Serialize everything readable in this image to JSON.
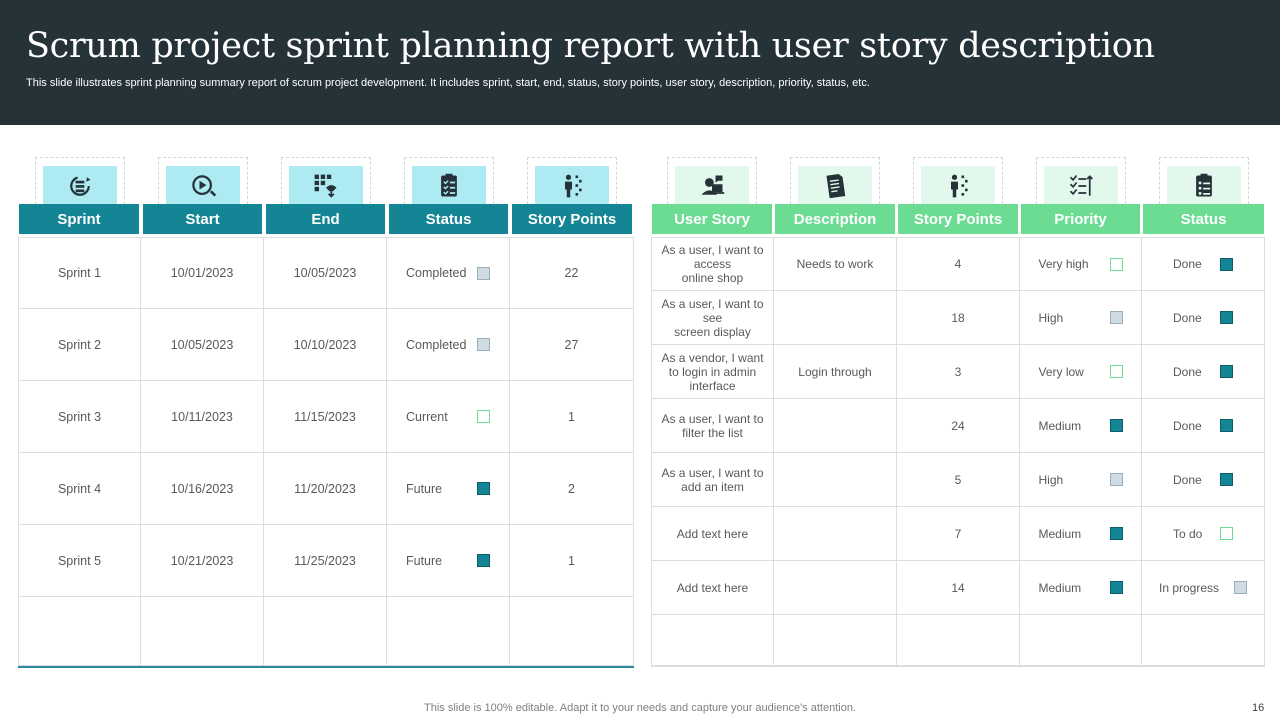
{
  "header": {
    "title": "Scrum project sprint planning report with user story description",
    "subtitle": "This slide illustrates sprint planning summary report of scrum project development. It includes sprint, start, end, status, story points, user story, description, priority, status, etc."
  },
  "left_table": {
    "columns": [
      "Sprint",
      "Start",
      "End",
      "Status",
      "Story Points"
    ],
    "icons": [
      "sprint-cycle-icon",
      "start-clock-icon",
      "end-calendar-icon",
      "status-checklist-icon",
      "story-points-icon"
    ],
    "rows": [
      {
        "sprint": "Sprint 1",
        "start": "10/01/2023",
        "end": "10/05/2023",
        "status": "Completed",
        "status_marker": "gray",
        "points": "22"
      },
      {
        "sprint": "Sprint 2",
        "start": "10/05/2023",
        "end": "10/10/2023",
        "status": "Completed",
        "status_marker": "gray",
        "points": "27"
      },
      {
        "sprint": "Sprint 3",
        "start": "10/11/2023",
        "end": "11/15/2023",
        "status": "Current",
        "status_marker": "hollow",
        "points": "1"
      },
      {
        "sprint": "Sprint 4",
        "start": "10/16/2023",
        "end": "11/20/2023",
        "status": "Future",
        "status_marker": "teal",
        "points": "2"
      },
      {
        "sprint": "Sprint 5",
        "start": "10/21/2023",
        "end": "11/25/2023",
        "status": "Future",
        "status_marker": "teal",
        "points": "1"
      }
    ]
  },
  "right_table": {
    "columns": [
      "User Story",
      "Description",
      "Story Points",
      "Priority",
      "Status"
    ],
    "icons": [
      "user-laptop-icon",
      "document-icon",
      "story-points-icon",
      "priority-list-icon",
      "status-clipboard-icon"
    ],
    "rows": [
      {
        "story": "As a user, I want to access\nonline shop",
        "description": "Needs to work",
        "points": "4",
        "priority": "Very high",
        "priority_marker": "hollow",
        "status": "Done",
        "status_marker": "teal"
      },
      {
        "story": "As a user, I want to see\nscreen display",
        "description": "",
        "points": "18",
        "priority": "High",
        "priority_marker": "gray",
        "status": "Done",
        "status_marker": "teal"
      },
      {
        "story": "As a vendor, I want to login in admin interface",
        "description": "Login through",
        "points": "3",
        "priority": "Very low",
        "priority_marker": "hollow",
        "status": "Done",
        "status_marker": "teal"
      },
      {
        "story": "As a user, I want to filter the list",
        "description": "",
        "points": "24",
        "priority": "Medium",
        "priority_marker": "teal",
        "status": "Done",
        "status_marker": "teal"
      },
      {
        "story": "As a user, I want to add an item",
        "description": "",
        "points": "5",
        "priority": "High",
        "priority_marker": "gray",
        "status": "Done",
        "status_marker": "teal"
      },
      {
        "story": "Add text here",
        "description": "",
        "points": "7",
        "priority": "Medium",
        "priority_marker": "teal",
        "status": "To do",
        "status_marker": "hollow"
      },
      {
        "story": "Add text here",
        "description": "",
        "points": "14",
        "priority": "Medium",
        "priority_marker": "teal",
        "status": "In progress",
        "status_marker": "gray"
      }
    ]
  },
  "colors": {
    "header_bg": "#253238",
    "teal": "#138594",
    "green": "#6bdc92",
    "icon_tile_left": "#aeeaf2",
    "icon_tile_right": "#e3f8ec"
  },
  "footer": {
    "note": "This slide is 100% editable. Adapt it to your needs and capture your audience's attention.",
    "page_number": "16"
  }
}
